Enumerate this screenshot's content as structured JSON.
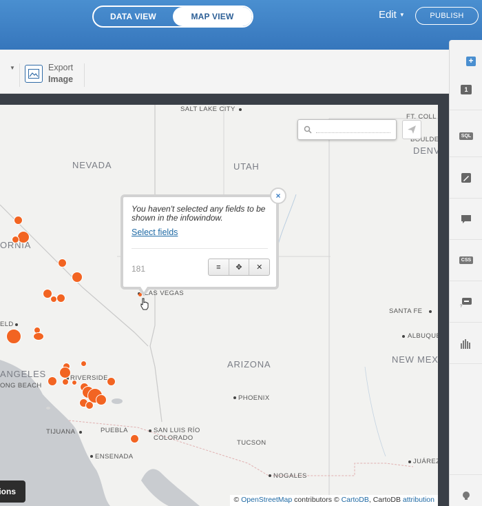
{
  "header": {
    "view_toggle": {
      "data_view": "DATA VIEW",
      "map_view": "MAP VIEW",
      "active": "map_view"
    },
    "edit_label": "Edit",
    "publish_label": "PUBLISH"
  },
  "toolbar": {
    "export": {
      "line1": "Export",
      "line2": "Image",
      "icon": "image-icon"
    }
  },
  "right_panel": {
    "add": "+",
    "items": [
      {
        "name": "layer-number",
        "label": "1"
      },
      {
        "name": "sql",
        "label": "SQL"
      },
      {
        "name": "wizard",
        "icon": "brush-icon"
      },
      {
        "name": "infowindow",
        "icon": "speech-bubble-icon"
      },
      {
        "name": "css",
        "label": "CSS"
      },
      {
        "name": "legends",
        "icon": "legend-icon"
      },
      {
        "name": "filters",
        "icon": "histogram-icon"
      }
    ]
  },
  "map": {
    "states": {
      "nevada": "NEVADA",
      "utah": "UTAH",
      "arizona": "ARIZONA",
      "new_mexico": "NEW MEXIC",
      "fornia": "ORNIA",
      "denv": "DENV"
    },
    "cities": {
      "salt_lake_city": "SALT LAKE CITY",
      "ft_coll": "FT. COLL",
      "boulder": "BOULDE",
      "las_vegas": "LAS VEGAS",
      "santa_fe": "SANTA FE",
      "albuquerque": "ALBUQUE",
      "phoenix": "PHOENIX",
      "tucson": "TUCSON",
      "nogales": "NOGALES",
      "juarez": "JUÁREZ",
      "riverside": "RIVERSIDE",
      "los_angeles": "ANGELES",
      "long_beach": "ONG BEACH",
      "tijuana": "TIJUANA",
      "ensenada": "ENSENADA",
      "puebla": "PUEBLA",
      "san_luis_rio_colorado_1": "SAN LUIS RÍO",
      "san_luis_rio_colorado_2": "COLORADO",
      "field": "ELD"
    },
    "search": {
      "placeholder": ""
    },
    "infowindow": {
      "message": "You haven't selected any fields to be shown in the infowindow.",
      "link": "Select fields",
      "value": "181",
      "close": "×",
      "buttons": [
        "≡",
        "✥",
        "✕"
      ]
    },
    "options_button": "ions",
    "attribution": {
      "prefix": "© ",
      "osm": "OpenStreetMap",
      "mid": " contributors © ",
      "cartodb": "CartoDB",
      "mid2": ", CartoDB ",
      "attr": "attribution"
    },
    "point_color": "#f26422"
  }
}
